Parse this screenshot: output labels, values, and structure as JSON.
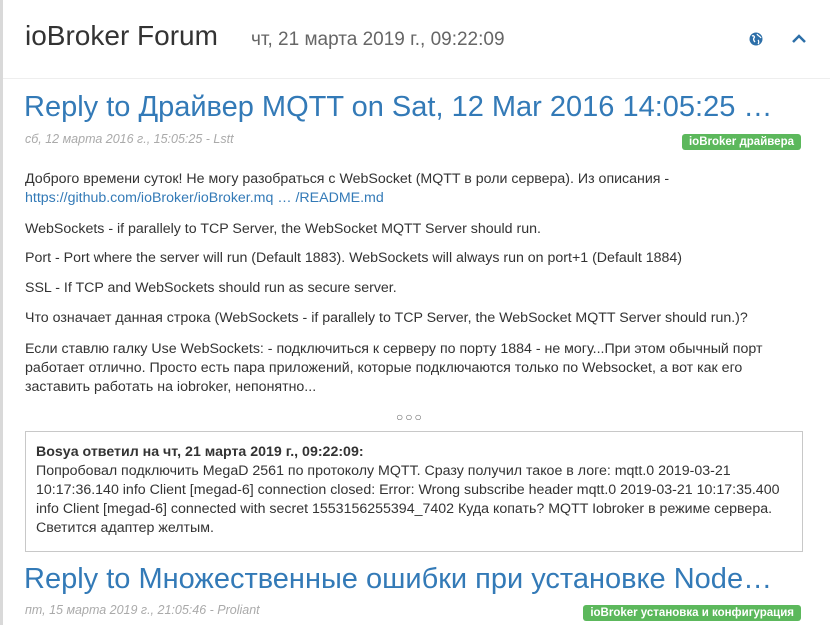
{
  "header": {
    "title": "ioBroker Forum",
    "time": "чт, 21 марта 2019 г., 09:22:09"
  },
  "posts": [
    {
      "title": "Reply to Драйвер MQTT on Sat, 12 Mar 2016 14:05:25 …",
      "meta": "сб, 12 марта 2016 г., 15:05:25 - Lstt",
      "badge": "ioBroker драйвера",
      "intro": "Доброго времени суток! Не могу разобраться с WebSocket (MQTT в роли сервера). Из описания -",
      "link": "https://github.com/ioBroker/ioBroker.mq … /README.md",
      "paragraphs": [
        "WebSockets - if parallely to TCP Server, the WebSocket MQTT Server should run.",
        "Port - Port where the server will run (Default 1883). WebSockets will always run on port+1 (Default 1884)",
        "SSL - If TCP and WebSockets should run as secure server.",
        "Что означает данная строка (WebSockets - if parallely to TCP Server, the WebSocket MQTT Server should run.)?",
        "Если ставлю галку Use WebSockets: - подключиться к серверу по порту 1884 - не могу...При этом обычный порт работает отлично. Просто есть пара приложений, которые подключаются только по Websocket, а вот как его заставить работать на iobroker, непонятно..."
      ],
      "dots": "○○○",
      "reply": {
        "head": "Bosya ответил на чт, 21 марта 2019 г., 09:22:09:",
        "body": "Попробовал подключить MegaD 2561 по протоколу MQTT. Сразу получил такое в логе: mqtt.0 2019-03-21 10:17:36.140 info Client [megad-6] connection closed: Error: Wrong subscribe header mqtt.0 2019-03-21 10:17:35.400 info Client [megad-6] connected with secret 1553156255394_7402 Куда копать? MQTT Iobroker в режиме сервера. Светится адаптер желтым."
      }
    },
    {
      "title": "Reply to Множественные ошибки при установке Node…",
      "meta": "пт, 15 марта 2019 г., 21:05:46 - Proliant",
      "badge": "ioBroker установка и конфигурация"
    }
  ],
  "icons": {
    "globe": "globe-icon",
    "chevron": "chevron-up-icon"
  },
  "colors": {
    "link": "#337ab7",
    "badge": "#5cb85c"
  }
}
